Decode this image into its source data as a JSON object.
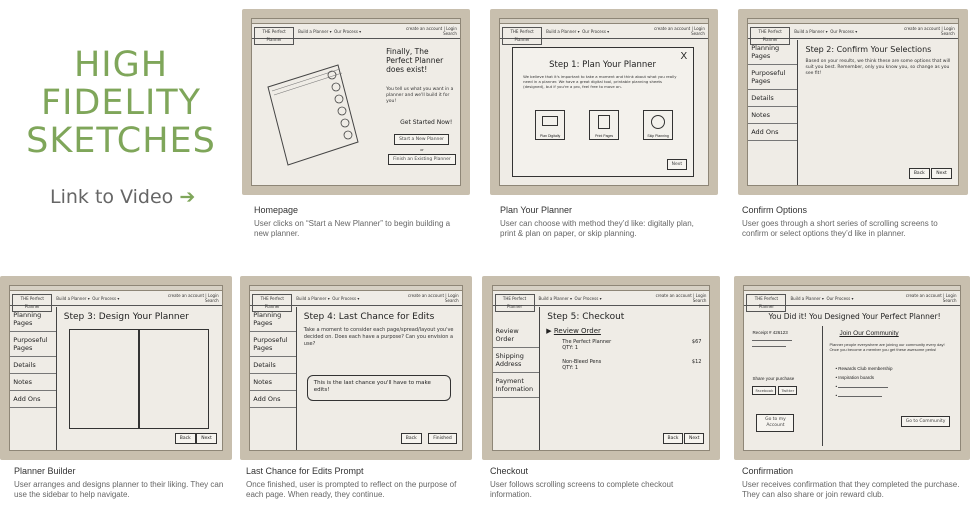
{
  "title": {
    "lines": [
      "HIGH",
      "FIDELITY",
      "SKETCHES"
    ]
  },
  "video_link": {
    "label": "Link to Video",
    "arrow": "➔"
  },
  "colors": {
    "accent": "#7fa65a",
    "paper": "#efece6",
    "photo_bg": "#c8bfae"
  },
  "sketch": {
    "logo": "THE Perfect Planner",
    "nav": [
      "Build a Planner ▾",
      "Our Process ▾",
      "Contact Us ▾"
    ],
    "right": [
      "create an account | Login",
      "Search"
    ],
    "sidebar": [
      "Planning Pages",
      "Purposeful Pages",
      "Details",
      "Notes",
      "Add Ons"
    ],
    "review_sidebar": [
      "Review Order",
      "Shipping Address",
      "Payment Information"
    ]
  },
  "cards": {
    "homepage": {
      "title": "Homepage",
      "desc": "User clicks on “Start a New Planner” to begin building a new planner.",
      "sketch": {
        "heading": "Finally, The Perfect Planner does exist!",
        "text": "You tell us what you want in a planner and we'll build it for you!",
        "cta": "Get Started Now!",
        "btn1": "Start a New Planner",
        "or": "or",
        "btn2": "Finish an Existing Planner"
      }
    },
    "plan_your_planner": {
      "title": "Plan Your Planner",
      "desc": "User can choose with method they’d like: digitally plan, print & plan on paper, or skip planning.",
      "sketch": {
        "heading": "Step 1: Plan Your Planner",
        "close": "X",
        "text": "We believe that it's important to take a moment and think about what you really need in a planner. We have a great digital tool, printable planning sheets (designed), but if you're a pro, feel free to move on.",
        "options": [
          "Plan Digitally",
          "Print Pages",
          "Skip Planning"
        ],
        "next": "Next"
      }
    },
    "confirm_options": {
      "title": "Confirm  Options",
      "desc": "User goes through a short series of scrolling screens to confirm or select options they’d like in planner.",
      "sketch": {
        "heading": "Step 2: Confirm Your Selections",
        "text": "Based on your results, we think these are some options that will suit you best. Remember, only you know you, so change as you see fit!",
        "back": "Back",
        "next": "Next"
      }
    },
    "planner_builder": {
      "title": "Planner Builder",
      "desc": "User arranges and designs planner to their liking. They can use the sidebar to help navigate.",
      "sketch": {
        "heading": "Step 3: Design Your Planner",
        "back": "Back",
        "next": "Next"
      }
    },
    "last_chance": {
      "title": "Last Chance for Edits Prompt",
      "desc": "Once finished, user is prompted to reflect on the purpose of each page. When ready, they continue.",
      "sketch": {
        "heading": "Step 4: Last Chance for Edits",
        "text": "Take a moment to consider each page/spread/layout you've decided on. Does each have a purpose? Can you envision a use?",
        "callout": "This is the last chance you'll have to make edits!",
        "back": "Back",
        "finish": "Finished"
      }
    },
    "checkout": {
      "title": "Checkout",
      "desc": "User follows scrolling screens to complete checkout information.",
      "sketch": {
        "heading": "Step 5: Checkout",
        "review": "Review Order",
        "items": [
          {
            "name": "The Perfect Planner",
            "qty": "QTY: 1",
            "price": "$67"
          },
          {
            "name": "Non-Bleed Pens",
            "qty": "QTY: 1",
            "price": "$12"
          }
        ],
        "back": "Back",
        "next": "Next"
      }
    },
    "confirmation": {
      "title": "Confirmation",
      "desc": "User receives confirmation that they completed the purchase. They can also share or join reward club.",
      "sketch": {
        "heading": "You Did it! You Designed Your Perfect Planner!",
        "receipt": "Receipt # 426123",
        "join": "Join Our Community",
        "join_text": "Planner people everywhere are joining our community every day! Once you become a member you get these awesome perks!",
        "perks": [
          "Rewards Club membership",
          "Inspiration boards",
          "",
          ""
        ],
        "share": "Share your purchase",
        "share_btns": [
          "Facebook",
          "Twitter"
        ],
        "account": "Go to my Account",
        "community": "Go to Community"
      }
    }
  }
}
